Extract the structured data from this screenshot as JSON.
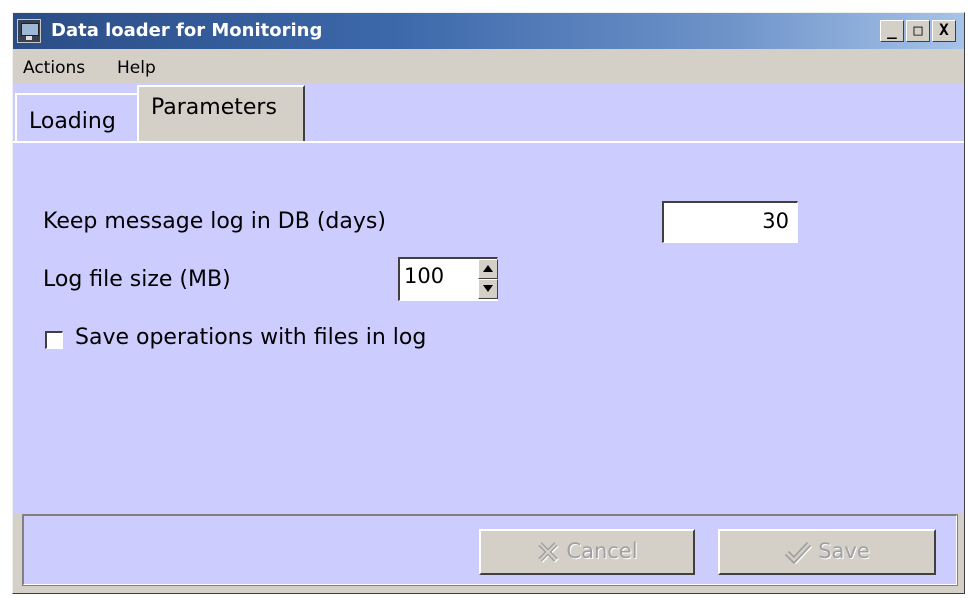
{
  "window": {
    "title": "Data loader for Monitoring",
    "controls": {
      "minimize": "_",
      "maximize": "□",
      "close": "X"
    }
  },
  "menu": {
    "items": [
      "Actions",
      "Help"
    ]
  },
  "tabs": [
    {
      "label": "Loading",
      "active": false
    },
    {
      "label": "Parameters",
      "active": true
    }
  ],
  "parameters": {
    "keep_log_label": "Keep message log in DB (days)",
    "keep_log_value": "30",
    "log_file_size_label": "Log file size (MB)",
    "log_file_size_value": "100",
    "save_ops_label": "Save operations with files in log",
    "save_ops_checked": false
  },
  "buttons": {
    "cancel_label": "Cancel",
    "cancel_icon": "cancel-x-icon",
    "save_label": "Save",
    "save_icon": "checkmark-icon",
    "enabled": false
  },
  "colors": {
    "panel_bg": "#ccccff",
    "window_bg": "#d4d0c8",
    "titlebar_start": "#2b4d86",
    "titlebar_end": "#a6c3e8"
  }
}
